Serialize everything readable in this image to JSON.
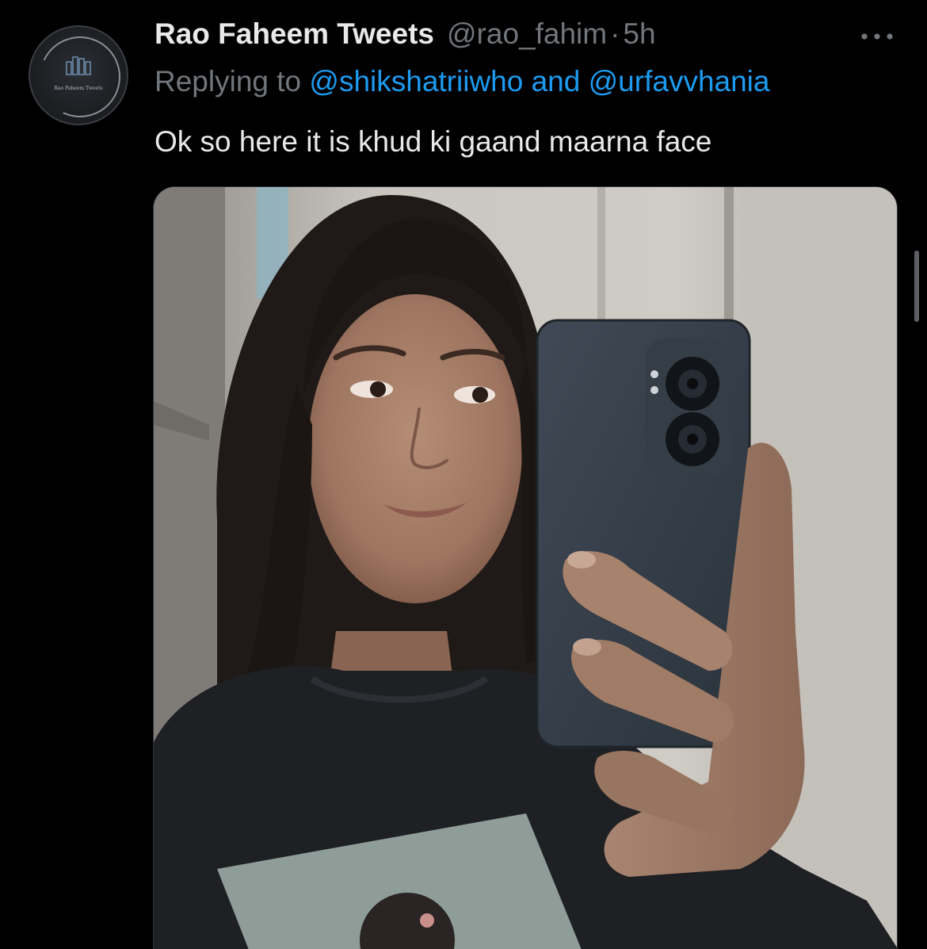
{
  "tweet": {
    "display_name": "Rao Faheem Tweets",
    "handle": "@rao_fahim",
    "separator": "·",
    "time": "5h",
    "replying_prefix": "Replying to",
    "mention_1": "@shikshatriiwho",
    "mention_joiner": "and",
    "mention_2": "@urfavvhania",
    "text": "Ok so here it is khud ki gaand maarna face",
    "avatar_caption": "Rao Faheem Tweets"
  },
  "icons": {
    "more": "more-horizontal-icon"
  },
  "colors": {
    "background": "#000000",
    "primary_text": "#e7e9ea",
    "secondary_text": "#71767b",
    "link": "#1d9bf0"
  }
}
